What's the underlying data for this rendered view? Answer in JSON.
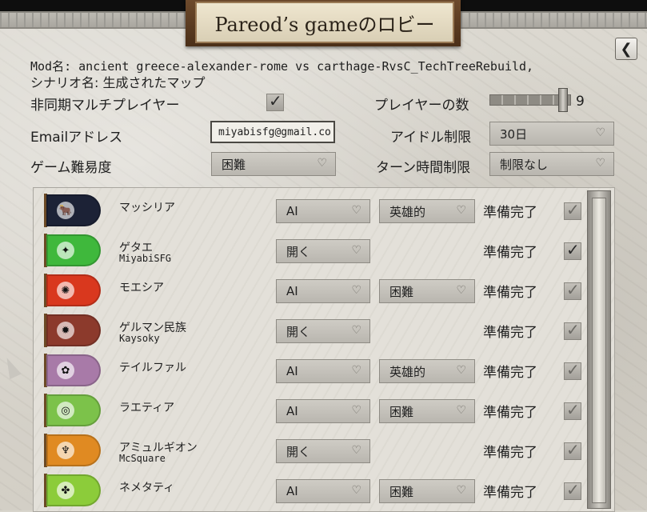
{
  "title": "Pareod’s gameのロビー",
  "mod_line": "Mod名: ancient greece-alexander-rome vs carthage-RvsC_TechTreeRebuild,",
  "scenario_line": "シナリオ名: 生成されたマップ",
  "settings": {
    "async_label": "非同期マルチプレイヤー",
    "async_checked": true,
    "players_label": "プレイヤーの数",
    "players_value": "9",
    "email_label": "Emailアドレス",
    "email_value": "miyabisfg@gmail.co",
    "idle_label": "アイドル制限",
    "idle_value": "30日",
    "difficulty_label": "ゲーム難易度",
    "difficulty_value": "困難",
    "turn_label": "ターン時間制限",
    "turn_value": "制限なし"
  },
  "icons": {
    "back": "back-arrow-icon",
    "check": "check-icon",
    "chevron": "chevron-down-icon",
    "cursor": "mouse-pointer-icon"
  },
  "players": [
    {
      "civ": "マッシリア",
      "player": "",
      "type": "AI",
      "difficulty": "英雄的",
      "ready": "準備完了",
      "checked": false,
      "color": "#1c2236",
      "emblem": "🐂"
    },
    {
      "civ": "ゲタエ",
      "player": "MiyabiSFG",
      "type": "開く",
      "difficulty": "",
      "ready": "準備完了",
      "checked": true,
      "color": "#3fb83c",
      "emblem": "✦"
    },
    {
      "civ": "モエシア",
      "player": "",
      "type": "AI",
      "difficulty": "困難",
      "ready": "準備完了",
      "checked": false,
      "color": "#d9381e",
      "emblem": "✺"
    },
    {
      "civ": "ゲルマン民族",
      "player": "Kaysoky",
      "type": "開く",
      "difficulty": "",
      "ready": "準備完了",
      "checked": false,
      "color": "#8c3a2c",
      "emblem": "✹"
    },
    {
      "civ": "テイルファル",
      "player": "",
      "type": "AI",
      "difficulty": "英雄的",
      "ready": "準備完了",
      "checked": false,
      "color": "#a87aa8",
      "emblem": "✿"
    },
    {
      "civ": "ラエティア",
      "player": "",
      "type": "AI",
      "difficulty": "困難",
      "ready": "準備完了",
      "checked": false,
      "color": "#7cc24a",
      "emblem": "◎"
    },
    {
      "civ": "アミュルギオン",
      "player": "McSquare",
      "type": "開く",
      "difficulty": "",
      "ready": "準備完了",
      "checked": false,
      "color": "#e08a22",
      "emblem": "♆"
    },
    {
      "civ": "ネメタティ",
      "player": "",
      "type": "AI",
      "difficulty": "困難",
      "ready": "準備完了",
      "checked": false,
      "color": "#8ccc3a",
      "emblem": "✤"
    }
  ]
}
